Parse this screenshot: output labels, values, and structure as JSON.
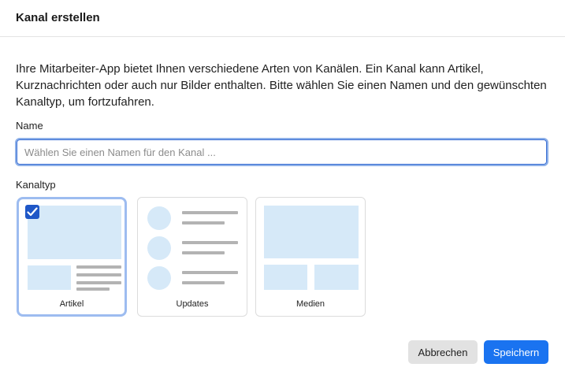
{
  "dialog": {
    "title": "Kanal erstellen",
    "description": "Ihre Mitarbeiter-App bietet Ihnen verschiedene Arten von Kanälen. Ein Kanal kann Artikel, Kurznachrichten oder auch nur Bilder enthalten. Bitte wählen Sie einen Namen und den gewünschten Kanaltyp, um fortzufahren.",
    "name_label": "Name",
    "name_input": {
      "value": "",
      "placeholder": "Wählen Sie einen Namen für den Kanal ..."
    },
    "type_label": "Kanaltyp",
    "channel_types": [
      {
        "label": "Artikel",
        "selected": true
      },
      {
        "label": "Updates",
        "selected": false
      },
      {
        "label": "Medien",
        "selected": false
      }
    ],
    "cancel_label": "Abbrechen",
    "save_label": "Speichern"
  },
  "colors": {
    "accent": "#1a73f0",
    "selected_border": "#9dbcf0",
    "placeholder_fill": "#d6e9f8",
    "checkbox": "#1f57c7"
  }
}
